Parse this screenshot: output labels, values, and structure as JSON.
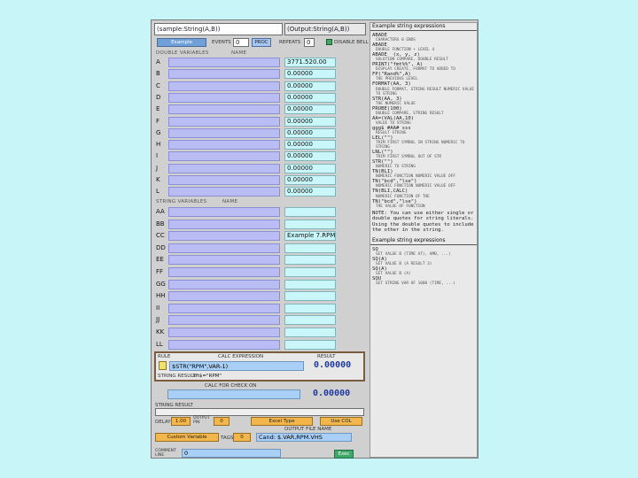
{
  "window": {
    "title_field": "(sample:String(A,B))",
    "title_right": "(Output:String(A,B))",
    "mode_select": "Example",
    "events_label": "EVENTS",
    "events_value": "0",
    "proc_label": "PROC",
    "repeats_label": "REPEATS",
    "repeats_value": "0",
    "checkbox_label": "DISABLE BELL"
  },
  "double_section": {
    "header": "DOUBLE VARIABLES",
    "name_header": "NAME",
    "rows": [
      {
        "letter": "A",
        "value": "3771.520.00"
      },
      {
        "letter": "B",
        "value": "0.00000"
      },
      {
        "letter": "C",
        "value": "0.00000"
      },
      {
        "letter": "D",
        "value": "0.00000"
      },
      {
        "letter": "E",
        "value": "0.00000"
      },
      {
        "letter": "F",
        "value": "0.00000"
      },
      {
        "letter": "G",
        "value": "0.00000"
      },
      {
        "letter": "H",
        "value": "0.00000"
      },
      {
        "letter": "I",
        "value": "0.00000"
      },
      {
        "letter": "J",
        "value": "0.00000"
      },
      {
        "letter": "K",
        "value": "0.00000"
      },
      {
        "letter": "L",
        "value": "0.00000"
      }
    ]
  },
  "string_section": {
    "header": "STRING VARIABLES",
    "name_header": "NAME",
    "rows": [
      {
        "letter": "AA",
        "value": ""
      },
      {
        "letter": "BB",
        "value": ""
      },
      {
        "letter": "CC",
        "value": "Example 7.RPM"
      },
      {
        "letter": "DD",
        "value": ""
      },
      {
        "letter": "EE",
        "value": ""
      },
      {
        "letter": "FF",
        "value": ""
      },
      {
        "letter": "GG",
        "value": ""
      },
      {
        "letter": "HH",
        "value": ""
      },
      {
        "letter": "II",
        "value": ""
      },
      {
        "letter": "JJ",
        "value": ""
      },
      {
        "letter": "KK",
        "value": ""
      },
      {
        "letter": "LL",
        "value": ""
      }
    ]
  },
  "calc_box": {
    "rule_label": "RULE",
    "calc_label": "CALC EXPRESSION",
    "result_label": "RESULT",
    "expression": "$STR(\"RPM\",VAR-1)",
    "result": "0.00000",
    "string_result_label": "STRING RESULT",
    "string_result": "sft$=\"RPM\""
  },
  "second_calc": {
    "label": "CALC FOR CHECK ON",
    "result": "0.00000",
    "string_result_label": "STRING RESULT"
  },
  "controls": {
    "delay_label": "DELAY",
    "delay_value": "1.00",
    "output_label": "OUTPUT PIN",
    "output_value": "0",
    "mode1": "Excel Type",
    "mode2": "Use COL",
    "driver": "Custom Variable",
    "tags_label": "TAGS",
    "tags_value": "0",
    "output_file_label": "OUTPUT FILE NAME",
    "output_file_value": "Cand: $.VAR,RPM.VHS"
  },
  "footer": {
    "comment_label": "COMMENT LINE",
    "comment_value": "0",
    "ok_button": "Exec"
  },
  "right_panel": {
    "header": "Example string expressions",
    "lines": [
      {
        "t": "ABADE",
        "s": "CHARACTERS 0 ENDS"
      },
      {
        "t": "ABADE",
        "s": "DOUBLE FUNCTION + LEVEL 4"
      },
      {
        "t": "ABADE  (x, y, z)",
        "s": "SOLUTION COMPARE, DOUBLE RESULT"
      },
      {
        "t": "PRINT(\"fmt%%\", A)",
        "s": "DISPLAY CREATE, FORMAT TO   ADDED TO"
      },
      {
        "t": "FP(\"Rand%\",A)",
        "s": "THE PREVIOUS LEVEL"
      },
      {
        "t": "FORMAT(AA, 3)",
        "s": "DOUBLE FORMAT, STRING RESULT  NUMERIC VALUE TO STRING"
      },
      {
        "t": "STR(AA, 3)",
        "s": "THE NUMERIC VALUE"
      },
      {
        "t": "PROBE(100)",
        "s": "DOUBLE COMPARE, STRING RESULT"
      },
      {
        "t": "AA=(VAL(AA,10)",
        "s": "VALUE TO STRING"
      },
      {
        "t": "ggg$ #AA# sss",
        "s": "RESULT STRING"
      },
      {
        "t": "LEL(\"\")",
        "s": "TRIM FIRST SYMBOL IN STRING  NUMERIC TO STRING"
      },
      {
        "t": "LNL(\"\")",
        "s": "TRIM FIRST SYMBOL OUT OF STR"
      },
      {
        "t": "STR(\"\")",
        "s": "NUMERIC TO STRING"
      },
      {
        "t": "TN(BLI)",
        "s": "NUMERIC FUNCTION  NUMERIC VALUE OFF"
      },
      {
        "t": "TN(\"bcd\",\"lse\")",
        "s": "NUMERIC FUNCTION  NUMERIC VALUE OFF"
      },
      {
        "t": "TN(BLI,CALC)",
        "s": "NUMERIC FUNCTION OF THE"
      },
      {
        "t": "TN(\"bcd\",\"lse\")",
        "s": "THE VALUE OF FUNCTION"
      }
    ],
    "note": "NOTE: You can use either single or double quotes for string literals. Using the double quotes to include the other in the string.",
    "header2": "Example string expressions",
    "lines2": [
      {
        "t": "SQ",
        "s": "SET VALUE B (TIME AT), AMB, ...)"
      },
      {
        "t": "SQ(A)",
        "s": "SET VALUE B (A RESULT 3)"
      },
      {
        "t": "SQ(A)",
        "s": "SET VALUE B (A)"
      },
      {
        "t": "SQU",
        "s": "SET STRING VAR OF 1000 (TIME, ...)"
      }
    ]
  }
}
